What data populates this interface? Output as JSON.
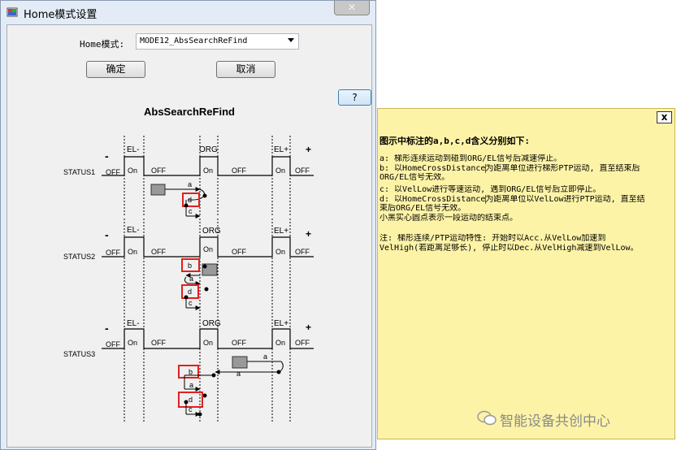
{
  "window": {
    "title": "Home模式设置"
  },
  "form": {
    "home_mode_label": "Home模式:",
    "home_mode_value": "MODE12_AbsSearchReFind",
    "ok_label": "确定",
    "cancel_label": "取消",
    "help_label": "?"
  },
  "diagram": {
    "title": "AbsSearchReFind",
    "minus": "-",
    "plus": "+",
    "el_minus": "EL-",
    "org": "ORG",
    "el_plus": "EL+",
    "off": "OFF",
    "on": "On",
    "status1": "STATUS1",
    "status2": "STATUS2",
    "status3": "STATUS3",
    "a": "a",
    "b": "b",
    "c": "c",
    "d": "d"
  },
  "tooltip": {
    "close_label": "x",
    "heading": "图示中标注的a,b,c,d含义分别如下:",
    "line_a": "a: 梯形连续运动到碰到ORG/EL信号后减速停止。",
    "line_b1": "b: 以HomeCrossDistance为距离单位进行梯形PTP运动, 直至结束后",
    "line_b2": "ORG/EL信号无效。",
    "line_c": "c: 以VelLow进行等速运动, 遇到ORG/EL信号后立即停止。",
    "line_d1": "d: 以HomeCrossDistance为距离单位以VelLow进行PTP运动, 直至结",
    "line_d2": "束后ORG/EL信号无效。",
    "line_dot": "小黑实心圆点表示一段运动的结束点。",
    "note1": "注: 梯形连续/PTP运动特性: 开始时以Acc.从VelLow加速到",
    "note2": "VelHigh(若距离足够长), 停止时以Dec.从VelHigh减速到VelLow。"
  },
  "watermark": {
    "text": "智能设备共创中心"
  }
}
